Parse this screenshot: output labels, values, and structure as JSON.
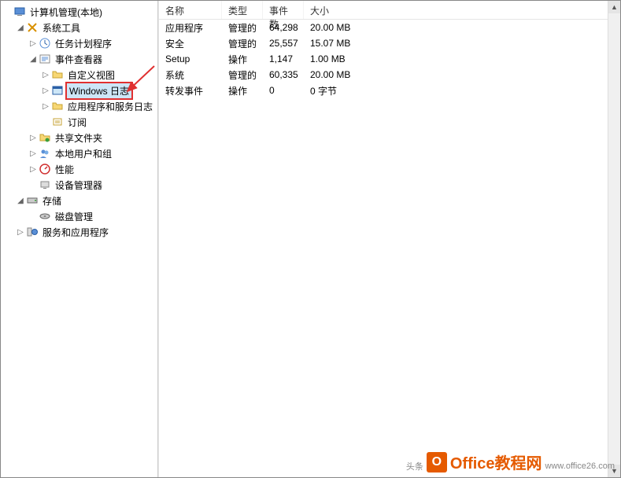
{
  "tree": {
    "root": "计算机管理(本地)",
    "sys_tools": "系统工具",
    "task_scheduler": "任务计划程序",
    "event_viewer": "事件查看器",
    "custom_views": "自定义视图",
    "windows_logs": "Windows 日志",
    "app_service_logs": "应用程序和服务日志",
    "subscriptions": "订阅",
    "shared_folders": "共享文件夹",
    "local_users": "本地用户和组",
    "performance": "性能",
    "device_manager": "设备管理器",
    "storage": "存储",
    "disk_mgmt": "磁盘管理",
    "services_apps": "服务和应用程序"
  },
  "columns": {
    "name": "名称",
    "type": "类型",
    "count": "事件数",
    "size": "大小"
  },
  "rows": [
    {
      "name": "应用程序",
      "type": "管理的",
      "count": "64,298",
      "size": "20.00 MB"
    },
    {
      "name": "安全",
      "type": "管理的",
      "count": "25,557",
      "size": "15.07 MB"
    },
    {
      "name": "Setup",
      "type": "操作",
      "count": "1,147",
      "size": "1.00 MB"
    },
    {
      "name": "系统",
      "type": "管理的",
      "count": "60,335",
      "size": "20.00 MB"
    },
    {
      "name": "转发事件",
      "type": "操作",
      "count": "0",
      "size": "0 字节"
    }
  ],
  "watermark": {
    "brand": "Office教程网",
    "url": "www.office26.com",
    "side": "头条"
  }
}
